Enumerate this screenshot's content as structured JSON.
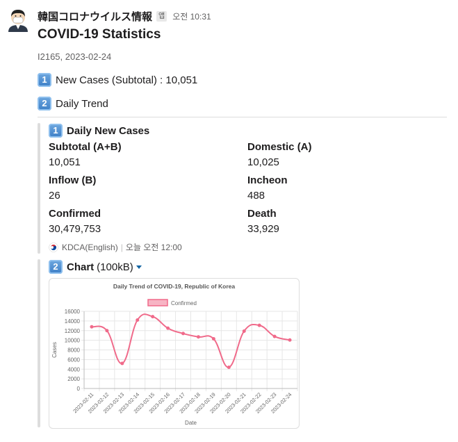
{
  "message": {
    "sender": "韓国コロナウイルス情報",
    "app_badge": "앱",
    "timestamp": "오전 10:31",
    "title": "COVID-19 Statistics",
    "subtitle": "I2165, 2023-02-24",
    "lines": [
      {
        "keycap": "1",
        "text": "New Cases (Subtotal) : 10,051"
      },
      {
        "keycap": "2",
        "text": "Daily Trend"
      }
    ]
  },
  "attachment_1": {
    "keycap": "1",
    "title": "Daily New Cases",
    "fields": [
      {
        "label": "Subtotal (A+B)",
        "value": "10,051"
      },
      {
        "label": "Domestic (A)",
        "value": "10,025"
      },
      {
        "label": "Inflow (B)",
        "value": "26"
      },
      {
        "label": "Incheon",
        "value": "488"
      },
      {
        "label": "Confirmed",
        "value": "30,479,753"
      },
      {
        "label": "Death",
        "value": "33,929"
      }
    ],
    "source": "KDCA(English)",
    "source_time": "오늘 오전 12:00"
  },
  "attachment_2": {
    "keycap": "2",
    "title": "Chart",
    "size": "(100kB)"
  },
  "chart_data": {
    "type": "line",
    "title": "Daily Trend of COVID-19, Republic of Korea",
    "xlabel": "Date",
    "ylabel": "Cases",
    "ylim": [
      0,
      16000
    ],
    "yticks": [
      0,
      2000,
      4000,
      6000,
      8000,
      10000,
      12000,
      14000,
      16000
    ],
    "grid": true,
    "legend_position": "top",
    "categories": [
      "2023-02-11",
      "2023-02-12",
      "2023-02-13",
      "2023-02-14",
      "2023-02-15",
      "2023-02-16",
      "2023-02-17",
      "2023-02-18",
      "2023-02-19",
      "2023-02-20",
      "2023-02-21",
      "2023-02-22",
      "2023-02-23",
      "2023-02-24"
    ],
    "series": [
      {
        "name": "Confirmed",
        "color": "#f06a8a",
        "values": [
          12800,
          12000,
          5200,
          14200,
          14900,
          12500,
          11400,
          10700,
          10300,
          4400,
          11900,
          13100,
          10800,
          10051
        ]
      }
    ]
  }
}
